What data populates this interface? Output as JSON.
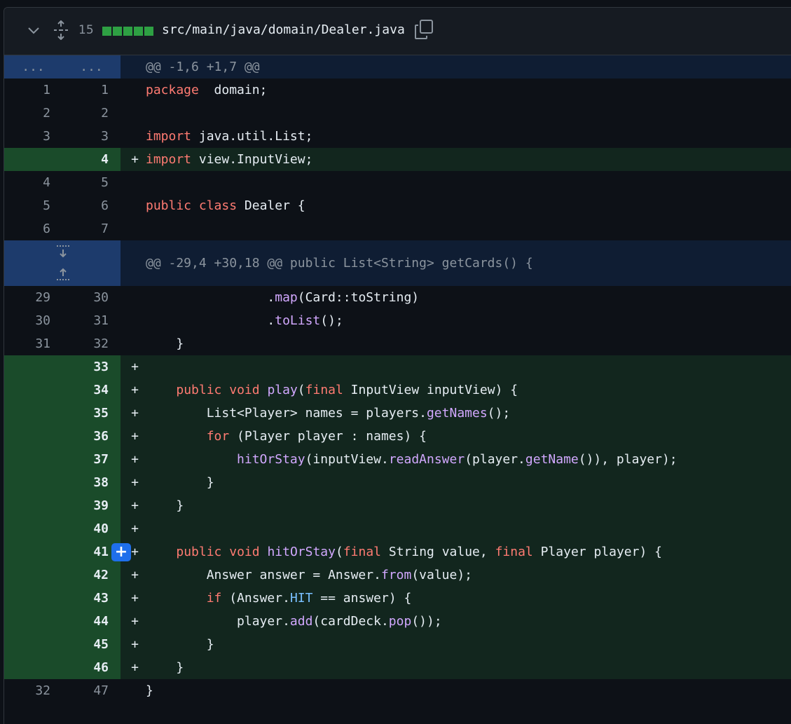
{
  "file": {
    "lines_changed": "15",
    "path": "src/main/java/domain/Dealer.java"
  },
  "hunks": [
    {
      "header": "@@ -1,6 +1,7 @@",
      "old": "...",
      "new": "..."
    },
    {
      "header": "@@ -29,4 +30,18 @@ public List<String> getCards() {"
    }
  ],
  "lines": [
    {
      "type": "ctx",
      "old": "1",
      "new": "1",
      "tokens": [
        [
          "kw",
          "package"
        ],
        [
          "",
          "  domain;"
        ]
      ]
    },
    {
      "type": "ctx",
      "old": "2",
      "new": "2",
      "tokens": []
    },
    {
      "type": "ctx",
      "old": "3",
      "new": "3",
      "tokens": [
        [
          "kw",
          "import"
        ],
        [
          "",
          " java.util.List;"
        ]
      ]
    },
    {
      "type": "add",
      "old": "",
      "new": "4",
      "tokens": [
        [
          "kw",
          "import"
        ],
        [
          "",
          " view.InputView;"
        ]
      ]
    },
    {
      "type": "ctx",
      "old": "4",
      "new": "5",
      "tokens": []
    },
    {
      "type": "ctx",
      "old": "5",
      "new": "6",
      "tokens": [
        [
          "kw",
          "public"
        ],
        [
          "",
          " "
        ],
        [
          "kw",
          "class"
        ],
        [
          "",
          " Dealer {"
        ]
      ]
    },
    {
      "type": "ctx",
      "old": "6",
      "new": "7",
      "tokens": []
    },
    {
      "type": "hunk2"
    },
    {
      "type": "ctx",
      "old": "29",
      "new": "30",
      "tokens": [
        [
          "",
          "                ."
        ],
        [
          "fn",
          "map"
        ],
        [
          "",
          "(Card::toString)"
        ]
      ]
    },
    {
      "type": "ctx",
      "old": "30",
      "new": "31",
      "tokens": [
        [
          "",
          "                ."
        ],
        [
          "fn",
          "toList"
        ],
        [
          "",
          "();"
        ]
      ]
    },
    {
      "type": "ctx",
      "old": "31",
      "new": "32",
      "tokens": [
        [
          "",
          "    }"
        ]
      ]
    },
    {
      "type": "add",
      "old": "",
      "new": "33",
      "tokens": []
    },
    {
      "type": "add",
      "old": "",
      "new": "34",
      "tokens": [
        [
          "",
          "    "
        ],
        [
          "kw",
          "public"
        ],
        [
          "",
          " "
        ],
        [
          "kw",
          "void"
        ],
        [
          "",
          " "
        ],
        [
          "fn",
          "play"
        ],
        [
          "",
          "("
        ],
        [
          "kw",
          "final"
        ],
        [
          "",
          " InputView inputView) {"
        ]
      ]
    },
    {
      "type": "add",
      "old": "",
      "new": "35",
      "tokens": [
        [
          "",
          "        List<Player> names = players."
        ],
        [
          "fn",
          "getNames"
        ],
        [
          "",
          "();"
        ]
      ]
    },
    {
      "type": "add",
      "old": "",
      "new": "36",
      "tokens": [
        [
          "",
          "        "
        ],
        [
          "kw",
          "for"
        ],
        [
          "",
          " (Player player : names) {"
        ]
      ]
    },
    {
      "type": "add",
      "old": "",
      "new": "37",
      "tokens": [
        [
          "",
          "            "
        ],
        [
          "fn",
          "hitOrStay"
        ],
        [
          "",
          "(inputView."
        ],
        [
          "fn",
          "readAnswer"
        ],
        [
          "",
          "(player."
        ],
        [
          "fn",
          "getName"
        ],
        [
          "",
          "()), player);"
        ]
      ]
    },
    {
      "type": "add",
      "old": "",
      "new": "38",
      "tokens": [
        [
          "",
          "        }"
        ]
      ]
    },
    {
      "type": "add",
      "old": "",
      "new": "39",
      "tokens": [
        [
          "",
          "    }"
        ]
      ]
    },
    {
      "type": "add",
      "old": "",
      "new": "40",
      "tokens": []
    },
    {
      "type": "add",
      "old": "",
      "new": "41",
      "plus_button": true,
      "tokens": [
        [
          "",
          "    "
        ],
        [
          "kw",
          "public"
        ],
        [
          "",
          " "
        ],
        [
          "kw",
          "void"
        ],
        [
          "",
          " "
        ],
        [
          "fn",
          "hitOrStay"
        ],
        [
          "",
          "("
        ],
        [
          "kw",
          "final"
        ],
        [
          "",
          " String value, "
        ],
        [
          "kw",
          "final"
        ],
        [
          "",
          " Player player) {"
        ]
      ]
    },
    {
      "type": "add",
      "old": "",
      "new": "42",
      "tokens": [
        [
          "",
          "        Answer answer = Answer."
        ],
        [
          "fn",
          "from"
        ],
        [
          "",
          "(value);"
        ]
      ]
    },
    {
      "type": "add",
      "old": "",
      "new": "43",
      "tokens": [
        [
          "",
          "        "
        ],
        [
          "kw",
          "if"
        ],
        [
          "",
          " (Answer."
        ],
        [
          "cn",
          "HIT"
        ],
        [
          "",
          " == answer) {"
        ]
      ]
    },
    {
      "type": "add",
      "old": "",
      "new": "44",
      "tokens": [
        [
          "",
          "            player."
        ],
        [
          "fn",
          "add"
        ],
        [
          "",
          "(cardDeck."
        ],
        [
          "fn",
          "pop"
        ],
        [
          "",
          "());"
        ]
      ]
    },
    {
      "type": "add",
      "old": "",
      "new": "45",
      "tokens": [
        [
          "",
          "        }"
        ]
      ]
    },
    {
      "type": "add",
      "old": "",
      "new": "46",
      "tokens": [
        [
          "",
          "    }"
        ]
      ]
    },
    {
      "type": "ctx",
      "old": "32",
      "new": "47",
      "tokens": [
        [
          "",
          "}"
        ]
      ]
    }
  ],
  "add_sign": "+",
  "plus_button_label": "+",
  "colors": {
    "keyword": "#ff7b72",
    "function": "#d2a8ff",
    "constant": "#79c0ff",
    "added_bg": "#12261e",
    "added_gutter": "#1a4b2a",
    "hunk_bg": "#0f1d33"
  }
}
